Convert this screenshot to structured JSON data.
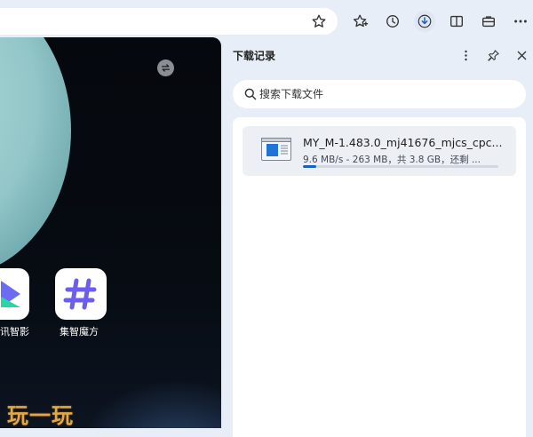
{
  "toolbar": {
    "icons": [
      "favorite-star-icon",
      "favorites-icon",
      "history-icon",
      "downloads-icon",
      "reading-view-icon",
      "briefcase-icon",
      "more-icon"
    ]
  },
  "content": {
    "apps": [
      {
        "label": "讯智影"
      },
      {
        "label": "集智魔方"
      }
    ],
    "watermark": "玩一玩"
  },
  "downloads_panel": {
    "title": "下载记录",
    "search": {
      "placeholder": "搜索下载文件",
      "value": ""
    },
    "items": [
      {
        "file_name": "MY_M-1.483.0_mj41676_mjcs_cpc...",
        "status": "9.6 MB/s - 263 MB，共 3.8 GB，还剩 ...",
        "progress": 0.068
      }
    ]
  },
  "colors": {
    "accent": "#1a5fc2",
    "toolbar_bg": "#e8eef8",
    "watermark": "#e0a848",
    "app_icon_blue": "#6c6cf2",
    "app_icon_teal": "#2bd6a5"
  }
}
